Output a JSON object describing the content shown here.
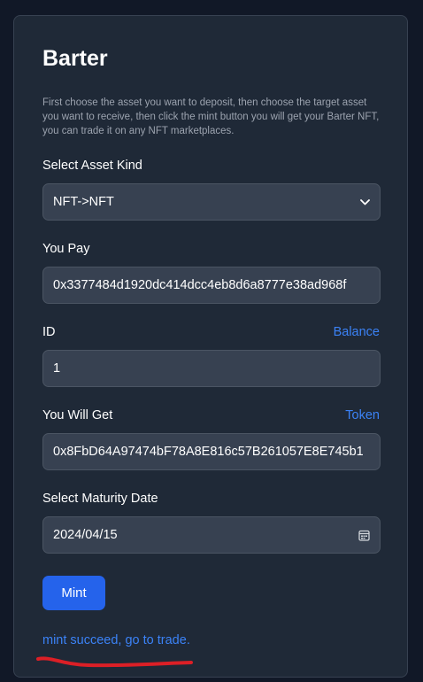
{
  "app": {
    "title": "Barter",
    "description": "First choose the asset you want to deposit, then choose the target asset you want to receive, then click the mint button you will get your Barter NFT, you can trade it on any NFT marketplaces."
  },
  "asset_kind": {
    "label": "Select Asset Kind",
    "value": "NFT->NFT",
    "icon": "chevron-down-icon"
  },
  "you_pay": {
    "label": "You Pay",
    "value": "0x3377484d1920dc414dcc4eb8d6a8777e38ad968f"
  },
  "id_field": {
    "label": "ID",
    "link": "Balance",
    "value": "1"
  },
  "you_will_get": {
    "label": "You Will Get",
    "link": "Token",
    "value": "0x8FbD64A97474bF78A8E816c57B261057E8E745b1"
  },
  "maturity": {
    "label": "Select Maturity Date",
    "value": "2024/04/15",
    "icon": "calendar-icon"
  },
  "mint_button": {
    "label": "Mint",
    "color": "#2563eb"
  },
  "status": {
    "text": "mint succeed, go to trade.",
    "annotation_color": "#dc1f26"
  },
  "colors": {
    "background": "#111827",
    "card": "#1f2937",
    "field": "#374151",
    "link": "#3b82f6"
  }
}
